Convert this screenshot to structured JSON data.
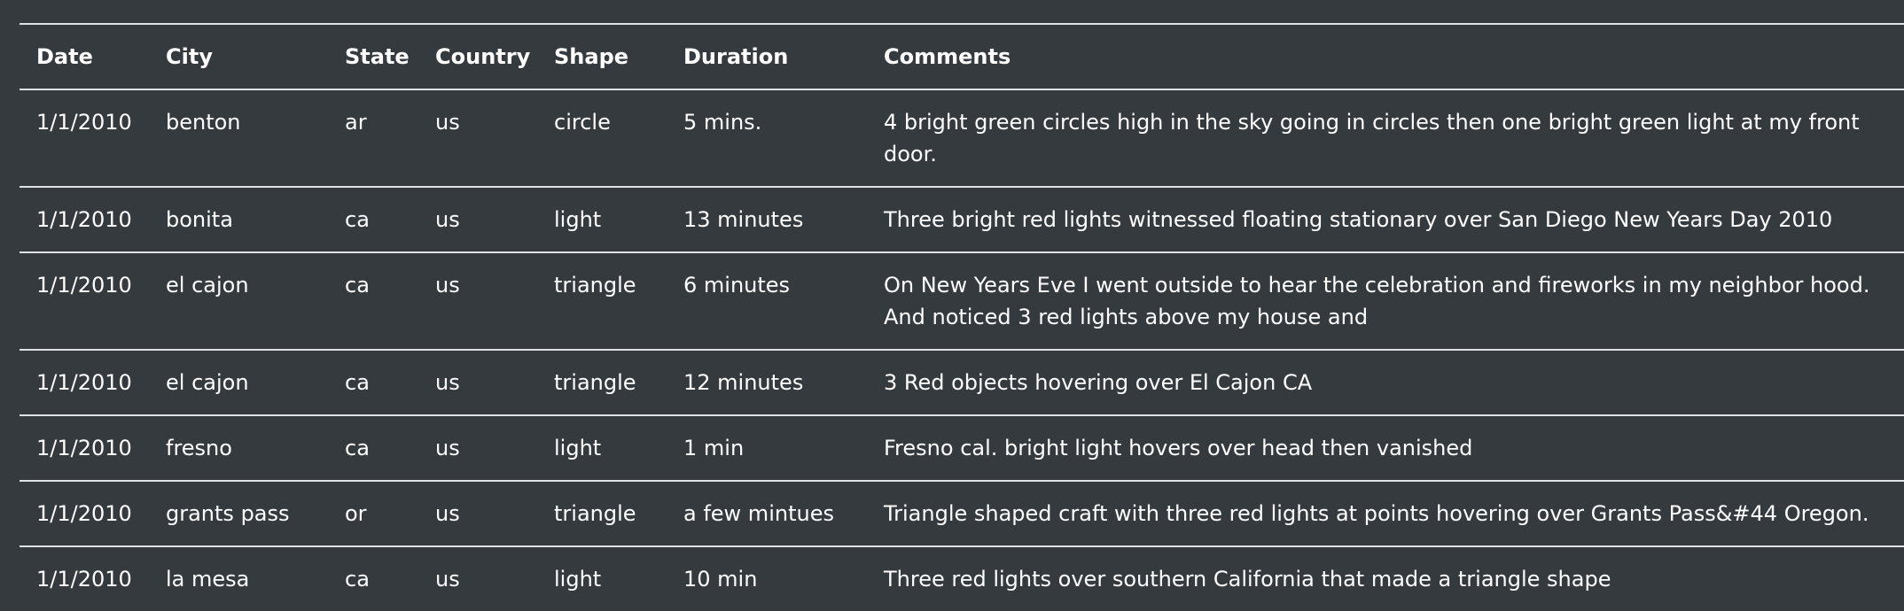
{
  "table": {
    "headers": [
      "Date",
      "City",
      "State",
      "Country",
      "Shape",
      "Duration",
      "Comments"
    ],
    "rows": [
      [
        "1/1/2010",
        "benton",
        "ar",
        "us",
        "circle",
        "5 mins.",
        "4 bright green circles high in the sky going in circles then one bright green light at my front door."
      ],
      [
        "1/1/2010",
        "bonita",
        "ca",
        "us",
        "light",
        "13 minutes",
        "Three bright red lights witnessed floating stationary over San Diego New Years Day 2010"
      ],
      [
        "1/1/2010",
        "el cajon",
        "ca",
        "us",
        "triangle",
        "6 minutes",
        "On New Years Eve I went outside to hear the celebration and fireworks in my neighbor hood. And noticed 3 red lights above my house and"
      ],
      [
        "1/1/2010",
        "el cajon",
        "ca",
        "us",
        "triangle",
        "12 minutes",
        "3 Red objects hovering over El Cajon CA"
      ],
      [
        "1/1/2010",
        "fresno",
        "ca",
        "us",
        "light",
        "1 min",
        "Fresno cal. bright light hovers over head then vanished"
      ],
      [
        "1/1/2010",
        "grants pass",
        "or",
        "us",
        "triangle",
        "a few mintues",
        "Triangle shaped craft with three red lights at points hovering over Grants Pass&#44 Oregon."
      ],
      [
        "1/1/2010",
        "la mesa",
        "ca",
        "us",
        "light",
        "10 min",
        "Three red lights over southern California that made a triangle shape"
      ]
    ]
  },
  "colors": {
    "background": "#353a3f",
    "text": "#ffffff",
    "border": "#dee2e6"
  }
}
